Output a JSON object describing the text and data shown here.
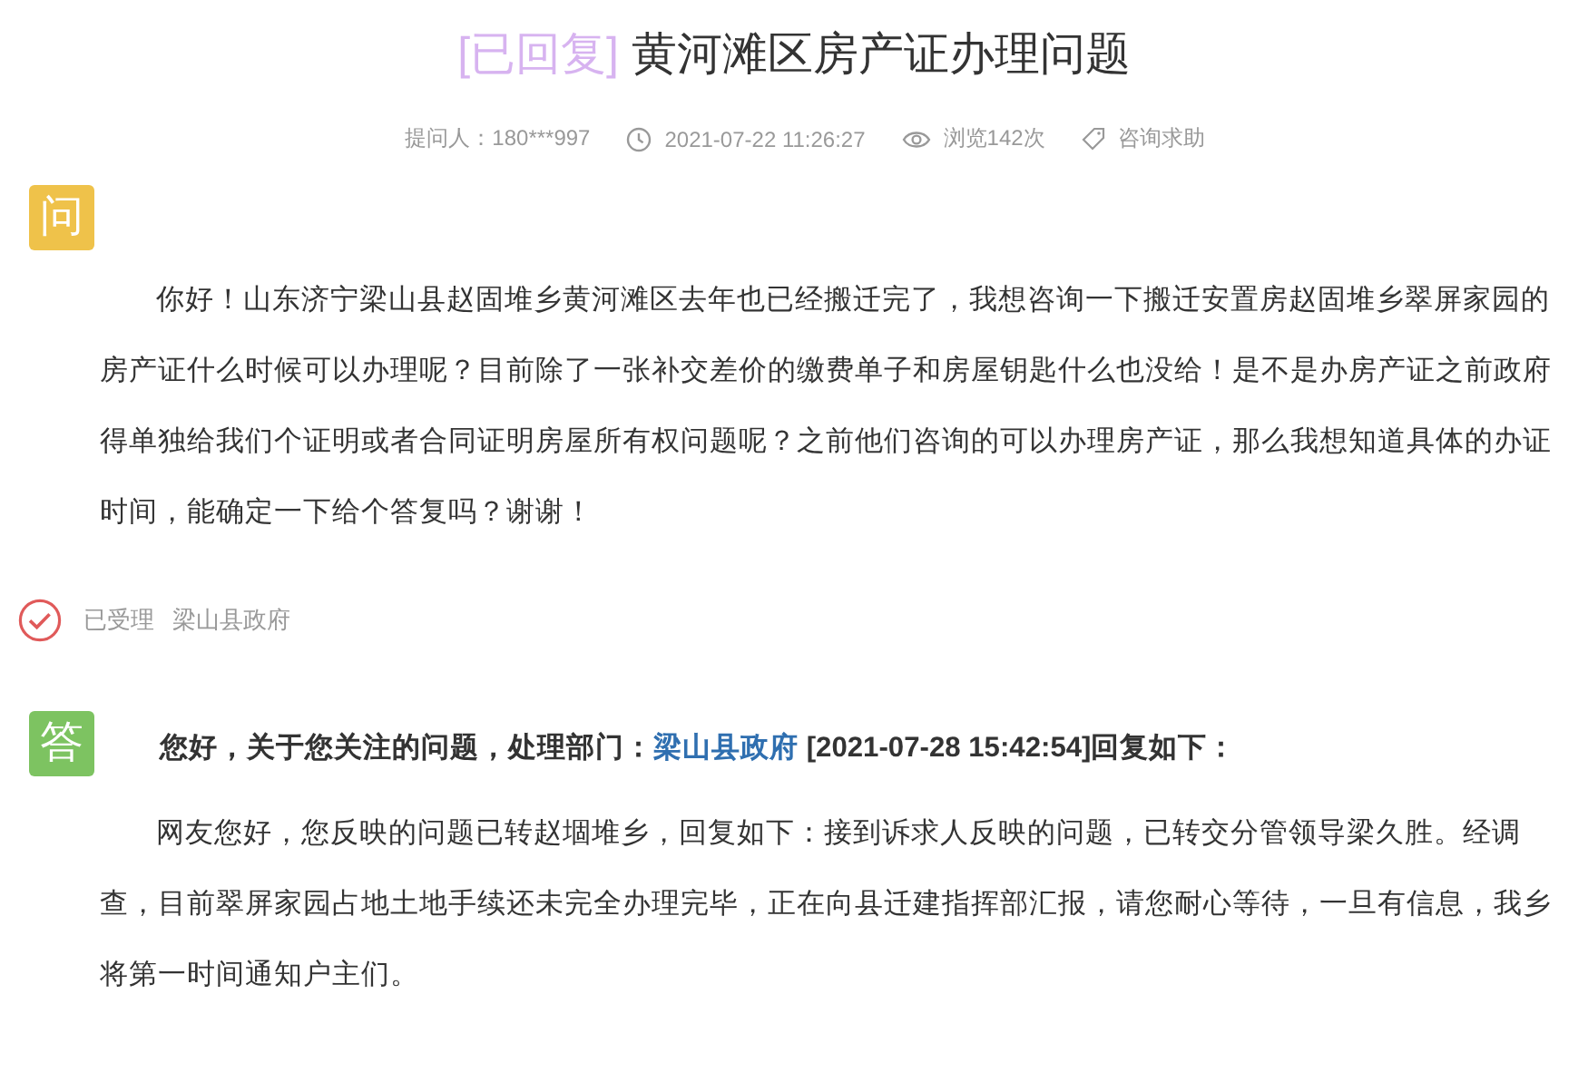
{
  "title": {
    "status": "[已回复]",
    "text": "黄河滩区房产证办理问题"
  },
  "meta": {
    "asker": "提问人：180***997",
    "time": "2021-07-22 11:26:27",
    "views": "浏览142次",
    "category": "咨询求助"
  },
  "question": {
    "badge": "问",
    "body": "你好！山东济宁梁山县赵固堆乡黄河滩区去年也已经搬迁完了，我想咨询一下搬迁安置房赵固堆乡翠屏家园的房产证什么时候可以办理呢？目前除了一张补交差价的缴费单子和房屋钥匙什么也没给！是不是办房产证之前政府得单独给我们个证明或者合同证明房屋所有权问题呢？之前他们咨询的可以办理房产证，那么我想知道具体的办证时间，能确定一下给个答复吗？谢谢！"
  },
  "status": {
    "label": "已受理",
    "department": "梁山县政府"
  },
  "answer": {
    "badge": "答",
    "header_prefix": "您好，关于您关注的问题，处理部门：",
    "department": "梁山县政府",
    "header_suffix": " [2021-07-28 15:42:54]回复如下：",
    "body": "网友您好，您反映的问题已转赵堌堆乡，回复如下：接到诉求人反映的问题，已转交分管领导梁久胜。经调查，目前翠屏家园占地土地手续还未完全办理完毕，正在向县迁建指挥部汇报，请您耐心等待，一旦有信息，我乡将第一时间通知户主们。"
  }
}
